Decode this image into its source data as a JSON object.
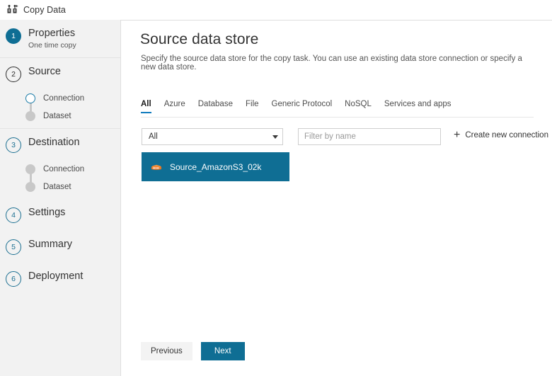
{
  "window": {
    "title": "Copy Data",
    "icon": "copy-data-icon"
  },
  "colors": {
    "accent_teal": "#0f6e94",
    "tab_underline": "#0f7bbd",
    "rail_background": "#f2f2f2",
    "s3_orange": "#e8761f",
    "inactive_dot": "#c8c8c8"
  },
  "sidebar": {
    "steps": [
      {
        "number": "1",
        "label": "Properties",
        "sublabel": "One time copy",
        "state": "completed",
        "substeps": []
      },
      {
        "number": "2",
        "label": "Source",
        "sublabel": "",
        "state": "current",
        "substeps": [
          {
            "label": "Connection",
            "state": "active"
          },
          {
            "label": "Dataset",
            "state": "inactive"
          }
        ]
      },
      {
        "number": "3",
        "label": "Destination",
        "sublabel": "",
        "state": "upcoming",
        "substeps": [
          {
            "label": "Connection",
            "state": "inactive"
          },
          {
            "label": "Dataset",
            "state": "inactive"
          }
        ]
      },
      {
        "number": "4",
        "label": "Settings",
        "sublabel": "",
        "state": "upcoming",
        "substeps": []
      },
      {
        "number": "5",
        "label": "Summary",
        "sublabel": "",
        "state": "upcoming",
        "substeps": []
      },
      {
        "number": "6",
        "label": "Deployment",
        "sublabel": "",
        "state": "upcoming",
        "substeps": []
      }
    ]
  },
  "main": {
    "title": "Source data store",
    "description": "Specify the source data store for the copy task. You can use an existing data store connection or specify a new data store.",
    "tabs": [
      {
        "label": "All",
        "selected": true
      },
      {
        "label": "Azure",
        "selected": false
      },
      {
        "label": "Database",
        "selected": false
      },
      {
        "label": "File",
        "selected": false
      },
      {
        "label": "Generic Protocol",
        "selected": false
      },
      {
        "label": "NoSQL",
        "selected": false
      },
      {
        "label": "Services and apps",
        "selected": false
      }
    ],
    "filter_bar": {
      "select_value": "All",
      "select_icon": "chevron-down-icon",
      "filter_value": "",
      "filter_placeholder": "Filter by name",
      "create_label": "Create new connection",
      "create_icon": "plus-icon"
    },
    "connections": [
      {
        "name": "Source_AmazonS3_02k",
        "icon": "amazon-s3-icon",
        "selected": true
      }
    ]
  },
  "footer": {
    "previous_label": "Previous",
    "next_label": "Next"
  }
}
